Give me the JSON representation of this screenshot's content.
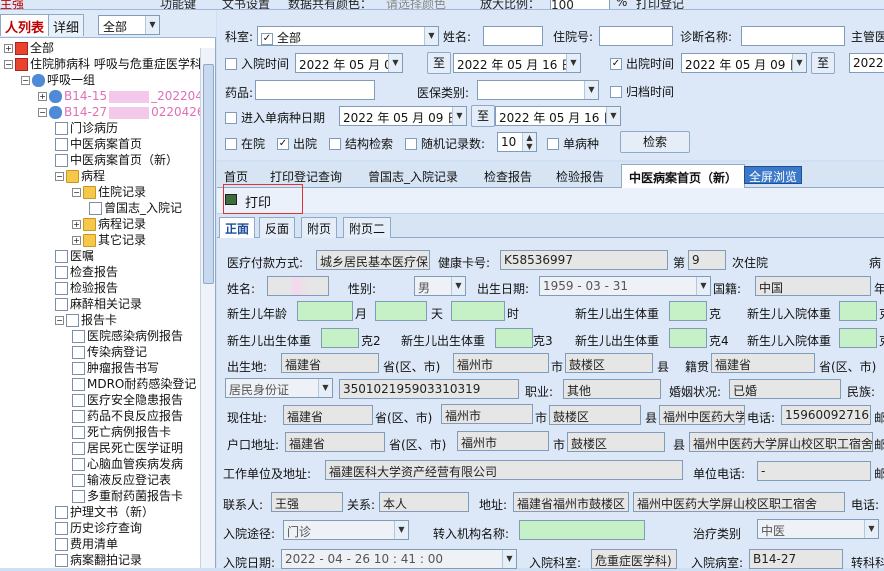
{
  "topbar": {
    "item1": "功能键",
    "item2": "文书设置",
    "item3": "数据共有颜色：",
    "item4": "请选择颜色",
    "item5": "放大比例：",
    "zoom": "100",
    "pct": "%",
    "item6": "打印登记",
    "left": "主强"
  },
  "left": {
    "tab_list": "人列表",
    "tab_detail": "详细",
    "dept_select": "全部",
    "tree": [
      {
        "label": "全部",
        "level": 0
      },
      {
        "label": "住院肺病科 呼吸与危重症医学科",
        "level": 0
      },
      {
        "label": "呼吸一组",
        "level": 1
      },
      {
        "label": "B14-15",
        "suffix": "_20220425",
        "level": 2
      },
      {
        "label": "B14-27",
        "suffix": "0220426",
        "level": 2
      },
      {
        "label": "门诊病历",
        "level": 3
      },
      {
        "label": "中医病案首页",
        "level": 3
      },
      {
        "label": "中医病案首页（新）",
        "level": 3
      },
      {
        "label": "病程",
        "level": 3
      },
      {
        "label": "住院记录",
        "level": 4
      },
      {
        "label": "曾国志_入院记",
        "level": 5
      },
      {
        "label": "病程记录",
        "level": 4
      },
      {
        "label": "其它记录",
        "level": 4
      },
      {
        "label": "医嘱",
        "level": 3
      },
      {
        "label": "检查报告",
        "level": 3
      },
      {
        "label": "检验报告",
        "level": 3
      },
      {
        "label": "麻醉相关记录",
        "level": 3
      },
      {
        "label": "报告卡",
        "level": 3
      },
      {
        "label": "医院感染病例报告",
        "level": 4
      },
      {
        "label": "传染病登记",
        "level": 4
      },
      {
        "label": "肿瘤报告书写",
        "level": 4
      },
      {
        "label": "MDRO耐药感染登记",
        "level": 4
      },
      {
        "label": "医疗安全隐患报告",
        "level": 4
      },
      {
        "label": "药品不良反应报告",
        "level": 4
      },
      {
        "label": "死亡病例报告卡",
        "level": 4
      },
      {
        "label": "居民死亡医学证明",
        "level": 4
      },
      {
        "label": "心脑血管疾病发病",
        "level": 4
      },
      {
        "label": "输液反应登记表",
        "level": 4
      },
      {
        "label": "多重耐药菌报告卡",
        "level": 4
      },
      {
        "label": "护理文书（新）",
        "level": 3
      },
      {
        "label": "历史诊疗查询",
        "level": 3
      },
      {
        "label": "费用清单",
        "level": 3
      },
      {
        "label": "病案翻拍记录",
        "level": 3
      }
    ]
  },
  "filter": {
    "dept_label": "科室:",
    "dept_value": "全部",
    "name_label": "姓名:",
    "inpatient_no_label": "住院号:",
    "diag_label": "诊断名称:",
    "doctor_label": "主管医",
    "admit_time_label": "入院时间",
    "admit_from": "2022 年 05 月 09 日",
    "to1": "至",
    "admit_to": "2022 年 05 月 16 日",
    "disch_time_label": "出院时间",
    "disch_from": "2022 年 05 月 09 日",
    "to2": "至",
    "disch_to": "2022",
    "drug_label": "药品:",
    "insurance_label": "医保类别:",
    "archive_label": "归档时间",
    "single_date_label": "进入单病种日期",
    "single_from": "2022 年 05 月 09 日",
    "to3": "至",
    "single_to": "2022 年 05 月 16 日",
    "in_hospital": "在院",
    "discharged": "出院",
    "structured": "结构检索",
    "random_label": "随机记录数:",
    "random_value": "10",
    "single_disease": "单病种",
    "search_btn": "检索"
  },
  "tabs": [
    "首页",
    "打印登记查询",
    "曾国志_入院记录",
    "检查报告",
    "检验报告",
    "中医病案首页（新）"
  ],
  "fullscreen": "全屏浏览",
  "print": "打印",
  "subtabs": [
    "正面",
    "反面",
    "附页",
    "附页二"
  ],
  "form": {
    "pay_label": "医疗付款方式:",
    "pay_value": "城乡居民基本医疗保险",
    "hcard_label": "健康卡号:",
    "hcard_value": "K58536997",
    "di": "第",
    "times": "9",
    "times_label": "次住院",
    "bing": "病",
    "name_label": "姓名:",
    "sex_label": "性别:",
    "sex_value": "男",
    "birth_label": "出生日期:",
    "birth_value": "1959 - 03 - 31",
    "nation_label": "国籍:",
    "nation_value": "中国",
    "age_cut": "年",
    "nb_age": "新生儿年龄",
    "month": "月",
    "day": "天",
    "hour": "时",
    "nb_weight": "新生儿出生体重",
    "ke": "克",
    "nb_in_weight": "新生儿入院体重",
    "ke_cut": "克",
    "nb_w1": "新生儿出生体重",
    "ke2": "克2",
    "nb_w3": "新生儿出生体重",
    "ke3": "克3",
    "nb_w4": "新生儿出生体重",
    "ke4": "克4",
    "nb_in2": "新生儿入院体重",
    "ke_cut2": "克",
    "birthplace_label": "出生地:",
    "bp_prov": "福建省",
    "prov_city": "省(区、市)",
    "bp_city": "福州市",
    "shi": "市",
    "bp_dist": "鼓楼区",
    "xian": "县",
    "jiguan_label": "籍贯",
    "jg_prov": "福建省",
    "prov_city2": "省(区、市)",
    "idtype": "居民身份证",
    "id_value": "350102195903310319",
    "job_label": "职业:",
    "job_value": "其他",
    "marriage_label": "婚姻状况:",
    "marriage_value": "已婚",
    "ethnic_label": "民族:",
    "addr_label": "现住址:",
    "addr_prov": "福建省",
    "prov_city3": "省(区、市)",
    "addr_city": "福州市",
    "shi2": "市",
    "addr_dist": "鼓楼区",
    "xian2": "县",
    "addr_detail": "福州中医药大学",
    "tel_label": "电话:",
    "tel_value": "15960092716",
    "you": "邮",
    "hukou_label": "户口地址:",
    "hk_prov": "福建省",
    "prov_city4": "省(区、市)",
    "hk_city": "福州市",
    "shi3": "市",
    "hk_dist": "鼓楼区",
    "xian3": "县",
    "hk_detail": "福州中医药大学屏山校区职工宿舍",
    "you2": "邮",
    "work_label": "工作单位及地址:",
    "work_value": "福建医科大学资产经营有限公司",
    "work_tel_label": "单位电话:",
    "work_tel_value": "-",
    "you3": "邮",
    "contact_label": "联系人:",
    "contact_value": "王强",
    "rel_label": "关系:",
    "rel_value": "本人",
    "contact_addr_label": "地址:",
    "contact_addr1": "福建省福州市鼓楼区",
    "contact_addr2": "福州中医药大学屏山校区职工宿舍",
    "contact_tel_label": "电话:",
    "route_label": "入院途径:",
    "route_value": "门诊",
    "transfer_label": "转入机构名称:",
    "treat_label": "治疗类别",
    "treat_value": "中医",
    "admit_date_label": "入院日期:",
    "admit_date_value": "2022 - 04 - 26 10 : 41 : 00",
    "admit_dept_label": "入院科室:",
    "admit_dept_value": "危重症医学科)",
    "admit_ward_label": "入院病室:",
    "admit_ward_value": "B14-27",
    "transfer_dept": "转科科"
  }
}
